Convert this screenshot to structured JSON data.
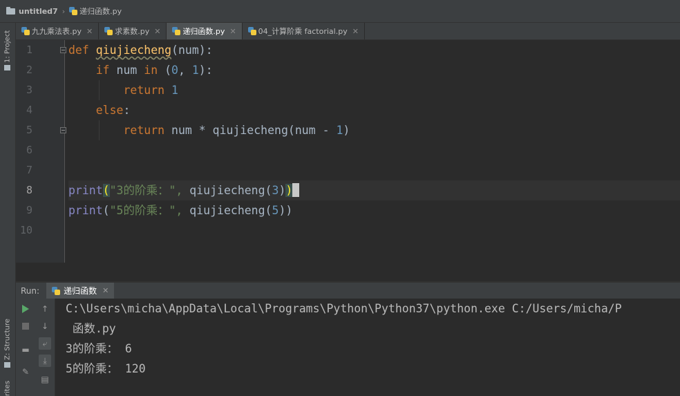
{
  "breadcrumb": {
    "project": "untitled7",
    "file": "递归函数.py"
  },
  "left_tools": {
    "project_tab": "1: Project",
    "structure_tab": "Z: Structure",
    "favorites_tab": "rites"
  },
  "tabs": [
    {
      "label": "九九乘法表.py",
      "active": false
    },
    {
      "label": "求素数.py",
      "active": false
    },
    {
      "label": "递归函数.py",
      "active": true
    },
    {
      "label": "04_计算阶乘 factorial.py",
      "active": false
    }
  ],
  "editor": {
    "line_numbers": [
      "1",
      "2",
      "3",
      "4",
      "5",
      "6",
      "7",
      "8",
      "9",
      "10"
    ],
    "current_line": "8",
    "code": {
      "l1": {
        "kw": "def",
        "fn": "qiujiecheng",
        "rest": "(num):"
      },
      "l2": {
        "kw_if": "if",
        "var": " num ",
        "kw_in": "in",
        "open": " (",
        "n0": "0",
        "comma": ", ",
        "n1": "1",
        "close": "):"
      },
      "l3": {
        "kw": "return",
        "num": "1"
      },
      "l4": {
        "kw": "else",
        "colon": ":"
      },
      "l5": {
        "kw": "return",
        "mid": " num * qiujiecheng(num - ",
        "num": "1",
        "close": ")"
      },
      "l8": {
        "fn": "print",
        "open": "(",
        "str": "\"3的阶乘：\", ",
        "call": "qiujiecheng(",
        "num": "3",
        "close1": ")",
        "close2": ")"
      },
      "l9": {
        "fn": "print",
        "open": "(",
        "str": "\"5的阶乘：\", ",
        "call": "qiujiecheng(",
        "num": "5",
        "close": "))"
      }
    }
  },
  "run": {
    "label": "Run:",
    "tab": "递归函数",
    "output": [
      "C:\\Users\\micha\\AppData\\Local\\Programs\\Python\\Python37\\python.exe C:/Users/micha/P",
      " 函数.py",
      "3的阶乘： 6",
      "5的阶乘： 120"
    ]
  }
}
